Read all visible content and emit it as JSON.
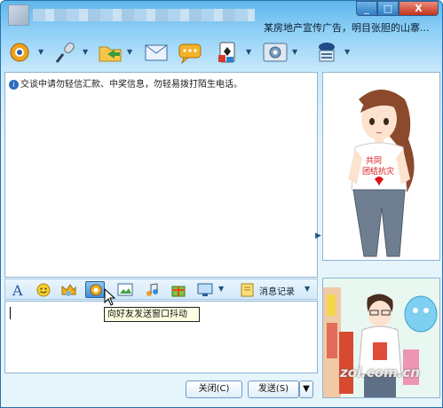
{
  "titlebar": {
    "ad_text": "某房地产宣传广告，明目张胆的山寨...",
    "minimize": "_",
    "maximize": "□",
    "close": "X"
  },
  "toolbar": {
    "icons": [
      "video-call-icon",
      "voice-mic-icon",
      "file-transfer-icon",
      "mail-icon",
      "message-bubble-icon",
      "game-icon",
      "settings-icon",
      "security-icon"
    ]
  },
  "chat": {
    "notice": "交谈中请勿轻信汇款、中奖信息，勿轻易拨打陌生电话。",
    "tooltip": "向好友发送窗口抖动",
    "history_label": "消息记录"
  },
  "buttons": {
    "close": "关闭(C)",
    "send": "发送(S)",
    "send_arrow": "▼"
  },
  "watermark": "zol.com.cn",
  "colors": {
    "titlebar_top": "#5fb6ec",
    "window_body": "#e6f4fc",
    "close_red": "#c2351d"
  }
}
